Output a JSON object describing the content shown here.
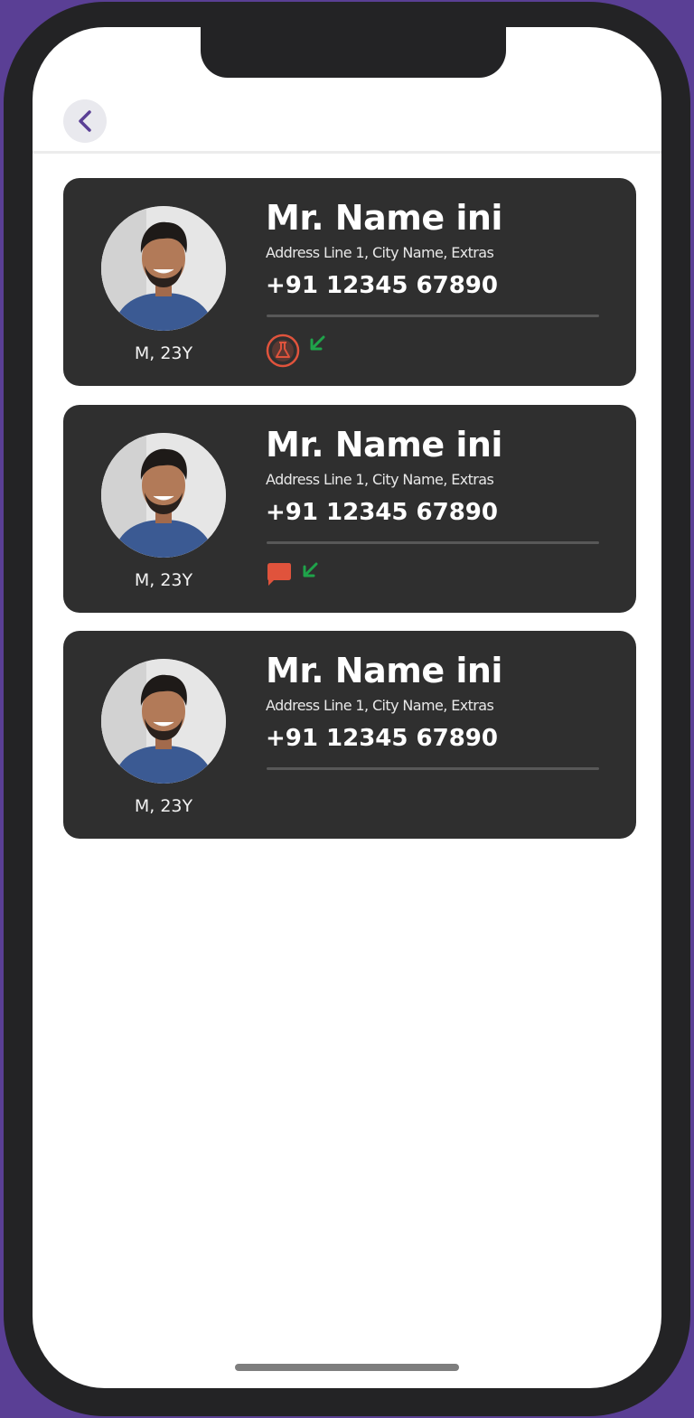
{
  "header": {
    "back_icon": "chevron-left-icon"
  },
  "colors": {
    "accent": "#5a3f95",
    "card_bg": "#2f2f2f",
    "alert_red": "#e0533c",
    "incoming_green": "#1fa34a"
  },
  "patients": [
    {
      "name": "Mr. Name ini",
      "address": "Address Line 1, City Name, Extras",
      "phone": "+91 12345 67890",
      "meta": "M, 23Y",
      "status_icons": [
        "lab-flask-icon",
        "incoming-arrow-icon"
      ]
    },
    {
      "name": "Mr. Name ini",
      "address": "Address Line 1, City Name, Extras",
      "phone": "+91 12345 67890",
      "meta": "M, 23Y",
      "status_icons": [
        "chat-bubble-icon",
        "incoming-arrow-icon"
      ]
    },
    {
      "name": "Mr. Name ini",
      "address": "Address Line 1, City Name, Extras",
      "phone": "+91 12345 67890",
      "meta": "M, 23Y",
      "status_icons": []
    }
  ]
}
